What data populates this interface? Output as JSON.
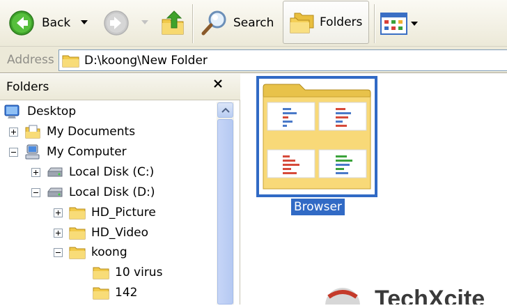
{
  "toolbar": {
    "back_label": "Back",
    "search_label": "Search",
    "folders_label": "Folders"
  },
  "address": {
    "label": "Address",
    "value": "D:\\koong\\New Folder"
  },
  "folders_pane": {
    "title": "Folders",
    "tree": [
      {
        "label": "Desktop",
        "icon": "desktop-icon",
        "expander": "none"
      },
      {
        "label": "My Documents",
        "icon": "my-documents-icon",
        "expander": "plus"
      },
      {
        "label": "My Computer",
        "icon": "my-computer-icon",
        "expander": "minus"
      },
      {
        "label": "Local Disk (C:)",
        "icon": "local-disk-icon",
        "expander": "plus"
      },
      {
        "label": "Local Disk (D:)",
        "icon": "local-disk-icon",
        "expander": "minus"
      },
      {
        "label": "HD_Picture",
        "icon": "folder-icon",
        "expander": "plus"
      },
      {
        "label": "HD_Video",
        "icon": "folder-icon",
        "expander": "plus"
      },
      {
        "label": "koong",
        "icon": "folder-icon",
        "expander": "minus"
      },
      {
        "label": "10 virus",
        "icon": "folder-icon",
        "expander": "none"
      },
      {
        "label": "142",
        "icon": "folder-icon",
        "expander": "none"
      }
    ]
  },
  "content": {
    "items": [
      {
        "label": "Browser",
        "icon": "folder-thumbnail-icon",
        "selected": true
      }
    ]
  },
  "watermark": {
    "text": "TechXcite"
  },
  "colors": {
    "selection": "#316ac5",
    "toolbar_bg": "#ece9d8",
    "folder_yellow": "#f7d774"
  }
}
